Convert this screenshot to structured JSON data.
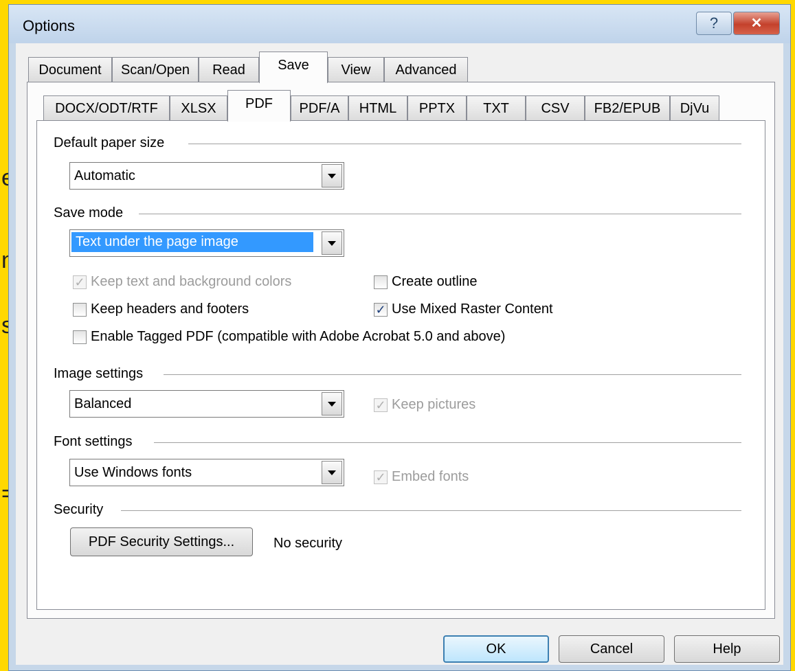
{
  "window": {
    "title": "Options",
    "help_glyph": "?",
    "close_glyph": "✕"
  },
  "main_tabs": [
    "Document",
    "Scan/Open",
    "Read",
    "Save",
    "View",
    "Advanced"
  ],
  "sub_tabs": [
    "DOCX/ODT/RTF",
    "XLSX",
    "PDF",
    "PDF/A",
    "HTML",
    "PPTX",
    "TXT",
    "CSV",
    "FB2/EPUB",
    "DjVu"
  ],
  "default_paper_size": {
    "label": "Default paper size",
    "value": "Automatic"
  },
  "save_mode": {
    "label": "Save mode",
    "value": "Text under the page image",
    "keep_colors": "Keep text and background colors",
    "create_outline": "Create outline",
    "keep_headers": "Keep headers and footers",
    "mixed_raster": "Use Mixed Raster Content",
    "tagged_pdf": "Enable Tagged PDF (compatible with Adobe Acrobat 5.0 and above)",
    "checkmark": "✓"
  },
  "image_settings": {
    "label": "Image settings",
    "value": "Balanced",
    "keep_pictures": "Keep pictures"
  },
  "font_settings": {
    "label": "Font settings",
    "value": "Use Windows fonts",
    "embed_fonts": "Embed fonts"
  },
  "security": {
    "label": "Security",
    "button": "PDF Security Settings...",
    "status": "No security"
  },
  "buttons": {
    "ok": "OK",
    "cancel": "Cancel",
    "help": "Help"
  },
  "background_glyphs": [
    "e",
    "n",
    "s",
    "="
  ],
  "colors": {
    "selection": "#3399ff",
    "frame": "#ffd800"
  }
}
